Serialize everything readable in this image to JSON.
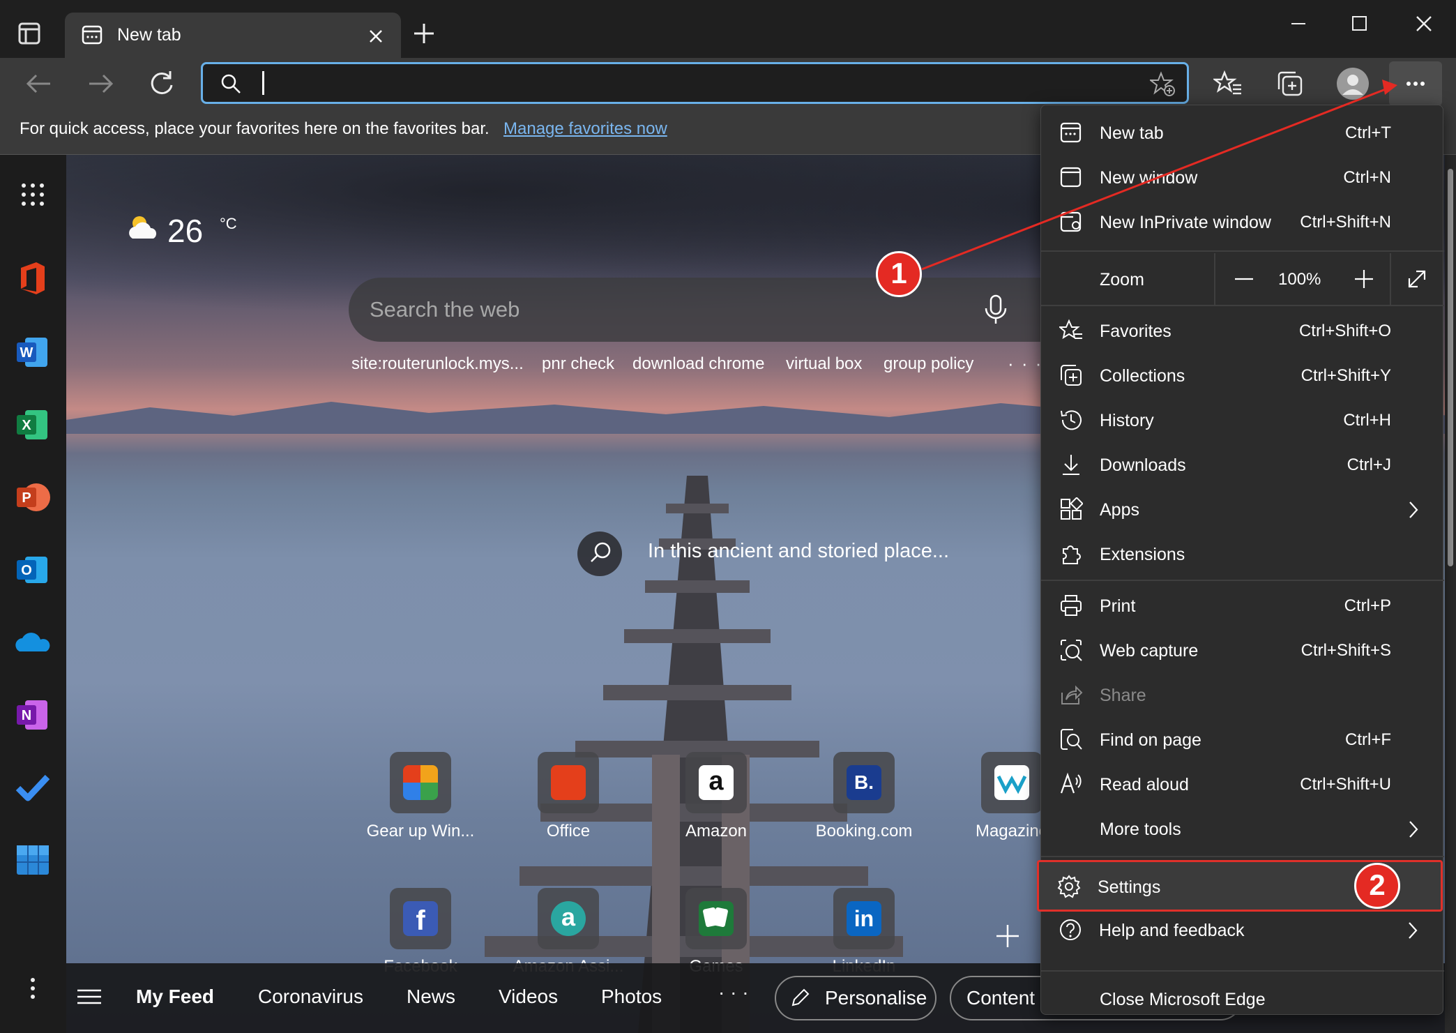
{
  "tab": {
    "title": "New tab"
  },
  "favorites_bar": {
    "message": "For quick access, place your favorites here on the favorites bar.",
    "link": "Manage favorites now"
  },
  "weather": {
    "temp": "26",
    "unit": "°C"
  },
  "search": {
    "placeholder": "Search the web"
  },
  "quick_links": [
    "site:routerunlock.mys...",
    "pnr check",
    "download chrome",
    "virtual box",
    "group policy"
  ],
  "image_caption": "In this ancient and storied place...",
  "tiles_row1": [
    {
      "label": "Gear up Win...",
      "color": "#f2a31b"
    },
    {
      "label": "Office",
      "color": "#e43f1b"
    },
    {
      "label": "Amazon",
      "color": "#ffffff"
    },
    {
      "label": "Booking.com",
      "color": "#1a3c8f"
    },
    {
      "label": "Magazine",
      "color": "#ffffff"
    }
  ],
  "tiles_row2": [
    {
      "label": "Facebook",
      "color": "#3b5bb5"
    },
    {
      "label": "Amazon Assi...",
      "color": "#2aa6a0"
    },
    {
      "label": "Games",
      "color": "#1e7a3a"
    },
    {
      "label": "LinkedIn",
      "color": "#0a66c2"
    }
  ],
  "feed": {
    "my_feed": "My Feed",
    "items": [
      "Coronavirus",
      "News",
      "Videos",
      "Photos"
    ],
    "personalise": "Personalise",
    "content": "Content"
  },
  "menu": {
    "new_tab": {
      "label": "New tab",
      "shortcut": "Ctrl+T"
    },
    "new_window": {
      "label": "New window",
      "shortcut": "Ctrl+N"
    },
    "new_inprivate": {
      "label": "New InPrivate window",
      "shortcut": "Ctrl+Shift+N"
    },
    "zoom": {
      "label": "Zoom",
      "value": "100%"
    },
    "favorites": {
      "label": "Favorites",
      "shortcut": "Ctrl+Shift+O"
    },
    "collections": {
      "label": "Collections",
      "shortcut": "Ctrl+Shift+Y"
    },
    "history": {
      "label": "History",
      "shortcut": "Ctrl+H"
    },
    "downloads": {
      "label": "Downloads",
      "shortcut": "Ctrl+J"
    },
    "apps": {
      "label": "Apps"
    },
    "extensions": {
      "label": "Extensions"
    },
    "print": {
      "label": "Print",
      "shortcut": "Ctrl+P"
    },
    "web_capture": {
      "label": "Web capture",
      "shortcut": "Ctrl+Shift+S"
    },
    "share": {
      "label": "Share"
    },
    "find_on_page": {
      "label": "Find on page",
      "shortcut": "Ctrl+F"
    },
    "read_aloud": {
      "label": "Read aloud",
      "shortcut": "Ctrl+Shift+U"
    },
    "more_tools": {
      "label": "More tools"
    },
    "settings": {
      "label": "Settings"
    },
    "help": {
      "label": "Help and feedback"
    },
    "close": {
      "label": "Close Microsoft Edge"
    }
  },
  "annotations": {
    "step1": "1",
    "step2": "2",
    "color": "#e42a23"
  }
}
